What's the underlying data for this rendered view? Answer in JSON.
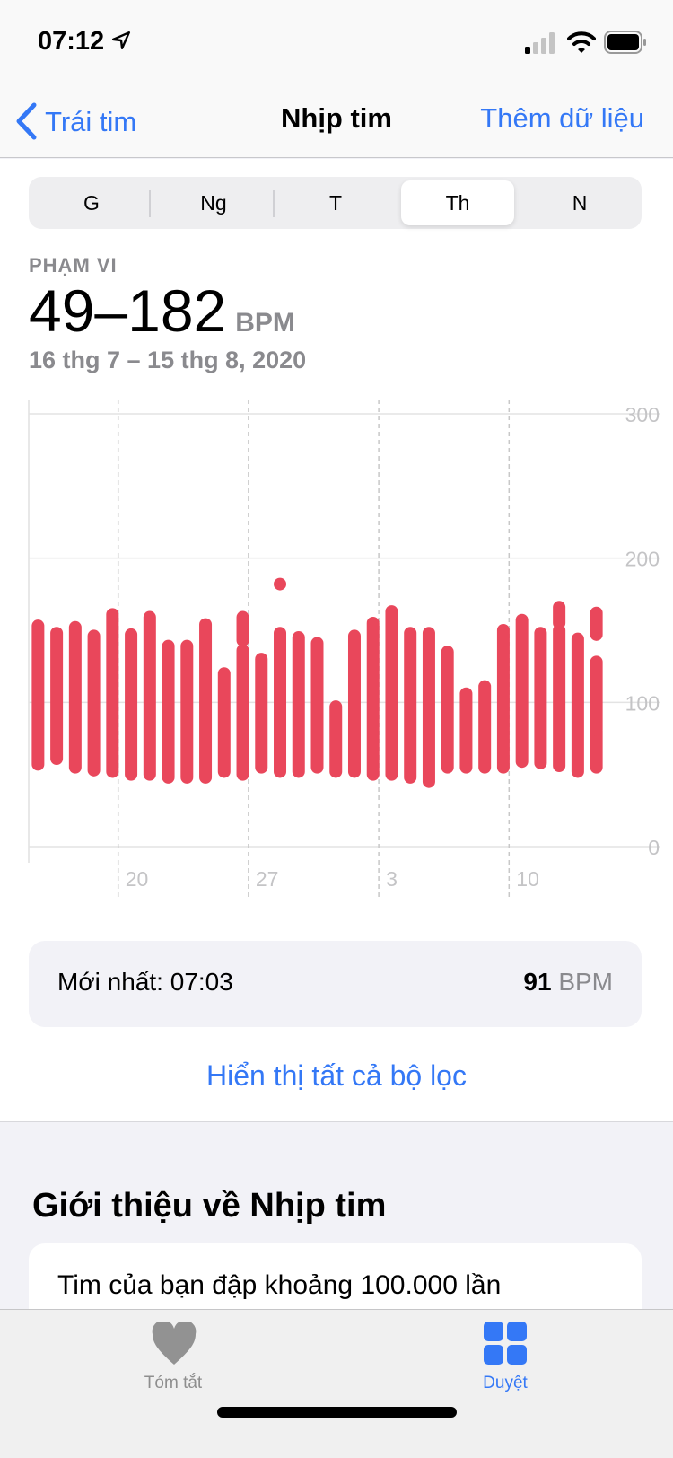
{
  "status_bar": {
    "time": "07:12",
    "icons": [
      "location-arrow-icon",
      "signal-icon",
      "wifi-icon",
      "battery-icon"
    ]
  },
  "nav": {
    "back_label": "Trái tim",
    "title": "Nhịp tim",
    "action_label": "Thêm dữ liệu"
  },
  "segments": {
    "items": [
      "G",
      "Ng",
      "T",
      "Th",
      "N"
    ],
    "selected": "Th"
  },
  "summary": {
    "label": "PHẠM VI",
    "value": "49–182",
    "unit": "BPM",
    "date_range": "16 thg 7 – 15 thg 8, 2020"
  },
  "chart_data": {
    "type": "range-bar",
    "ylim": [
      0,
      300
    ],
    "y_ticks": [
      "300",
      "200",
      "100",
      "0"
    ],
    "x_tick_labels": [
      "20",
      "27",
      "3",
      "10"
    ],
    "x_tick_days": [
      5,
      12,
      19,
      26
    ],
    "grid": true,
    "color": "#e9475b",
    "x": [
      "07-16",
      "07-17",
      "07-18",
      "07-19",
      "07-20",
      "07-21",
      "07-22",
      "07-23",
      "07-24",
      "07-25",
      "07-26",
      "07-27",
      "07-28",
      "07-29",
      "07-30",
      "07-31",
      "08-01",
      "08-02",
      "08-03",
      "08-04",
      "08-05",
      "08-06",
      "08-07",
      "08-08",
      "08-09",
      "08-10",
      "08-11",
      "08-12",
      "08-13",
      "08-14",
      "08-15"
    ],
    "ranges": [
      [
        [
          57,
          153
        ]
      ],
      [
        [
          61,
          148
        ]
      ],
      [
        [
          55,
          152
        ]
      ],
      [
        [
          53,
          146
        ]
      ],
      [
        [
          52,
          161
        ]
      ],
      [
        [
          50,
          147
        ]
      ],
      [
        [
          50,
          159
        ]
      ],
      [
        [
          48,
          139
        ]
      ],
      [
        [
          48,
          139
        ]
      ],
      [
        [
          48,
          154
        ]
      ],
      [
        [
          52,
          120
        ]
      ],
      [
        [
          50,
          136
        ],
        [
          143,
          159
        ]
      ],
      [
        [
          55,
          130
        ]
      ],
      [
        [
          52,
          148
        ],
        [
          182,
          182
        ]
      ],
      [
        [
          52,
          145
        ]
      ],
      [
        [
          55,
          141
        ]
      ],
      [
        [
          52,
          97
        ]
      ],
      [
        [
          52,
          146
        ]
      ],
      [
        [
          50,
          155
        ]
      ],
      [
        [
          50,
          163
        ]
      ],
      [
        [
          48,
          148
        ]
      ],
      [
        [
          45,
          148
        ]
      ],
      [
        [
          55,
          135
        ]
      ],
      [
        [
          55,
          106
        ]
      ],
      [
        [
          55,
          111
        ]
      ],
      [
        [
          55,
          150
        ]
      ],
      [
        [
          59,
          157
        ]
      ],
      [
        [
          58,
          148
        ]
      ],
      [
        [
          56,
          150
        ],
        [
          155,
          166
        ]
      ],
      [
        [
          52,
          144
        ]
      ],
      [
        [
          55,
          80
        ],
        [
          81,
          128
        ],
        [
          147,
          162
        ]
      ]
    ]
  },
  "latest": {
    "label": "Mới nhất: 07:03",
    "value": "91",
    "unit": "BPM"
  },
  "show_all_filters": "Hiển thị tất cả bộ lọc",
  "about": {
    "title": "Giới thiệu về Nhịp tim",
    "text": "Tim của bạn đập khoảng 100.000 lần"
  },
  "tabbar": {
    "items": [
      {
        "label": "Tóm tắt",
        "icon": "heart-icon",
        "active": false
      },
      {
        "label": "Duyệt",
        "icon": "grid-icon",
        "active": true
      }
    ]
  },
  "colors": {
    "accent": "#3478f6",
    "heart": "#e9475b"
  }
}
